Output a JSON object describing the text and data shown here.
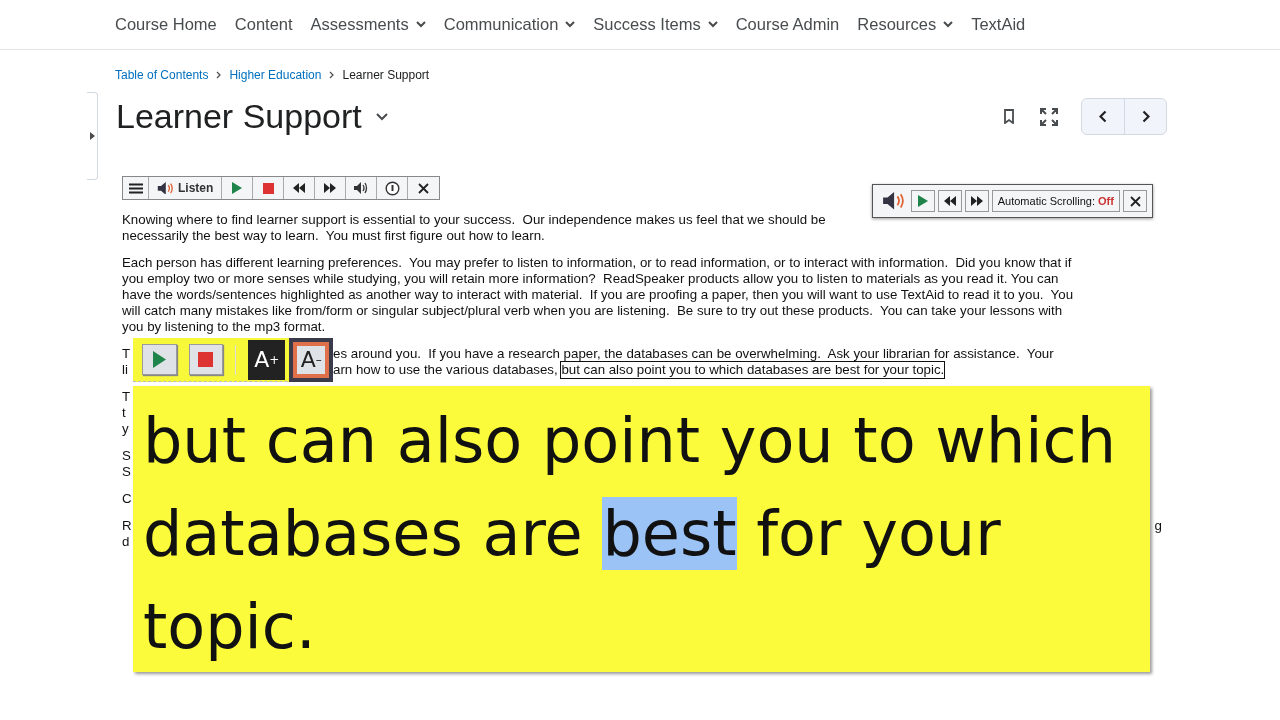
{
  "nav": [
    {
      "label": "Course Home",
      "dropdown": false
    },
    {
      "label": "Content",
      "dropdown": false
    },
    {
      "label": "Assessments",
      "dropdown": true
    },
    {
      "label": "Communication",
      "dropdown": true
    },
    {
      "label": "Success Items",
      "dropdown": true
    },
    {
      "label": "Course Admin",
      "dropdown": false
    },
    {
      "label": "Resources",
      "dropdown": true
    },
    {
      "label": "TextAid",
      "dropdown": false
    }
  ],
  "breadcrumbs": [
    {
      "label": "Table of Contents",
      "kind": "link"
    },
    {
      "label": "Higher Education",
      "kind": "link"
    },
    {
      "label": "Learner Support",
      "kind": "current"
    }
  ],
  "title": "Learner Support",
  "readspeaker": {
    "listen_label": "Listen"
  },
  "paragraphs": [
    {
      "lines": [
        {
          "head": "Knowing where to find learner support is essential to your success.  Our independence makes us feel that we should be"
        },
        {
          "head": "necessarily the best way to learn.  You must first figure out how to learn."
        }
      ]
    },
    {
      "lines": [
        {
          "head": "Each person has different learning preferences.  You may prefer to listen to information, or to read information, or to interact with information.  Did you know that if"
        },
        {
          "head": "you employ two or more senses while studying, you will retain more information?  ReadSpeaker products allow you to listen to materials as you read it. You can"
        },
        {
          "head": "have the words/sentences highlighted as another way to interact with material.  If you are proofing a paper, then you will want to use TextAid to read it to you.  You"
        },
        {
          "head": "will catch many mistakes like from/form or singular subject/plural verb when you are listening.  Be sure to try out these products.  You can take your lessons with"
        },
        {
          "head": "you by listening to the mp3 format."
        }
      ]
    },
    {
      "lines": [
        {
          "head": "T",
          "kind": "near",
          "tail": "es around you.  If you have a research paper, the databases can be overwhelming.  Ask your librarian for assistance.  Your"
        },
        {
          "head": "li",
          "kind": "near",
          "tail": "arn how to use the various databases, ",
          "current": "but can also point you to which databases are best for your topic."
        }
      ]
    },
    {
      "lines": [
        {
          "head": "T"
        },
        {
          "head": "t"
        },
        {
          "head": "y"
        }
      ]
    },
    {
      "lines": [
        {
          "head": "S"
        },
        {
          "head": "S"
        }
      ]
    },
    {
      "lines": [
        {
          "head": "C"
        }
      ]
    },
    {
      "lines": [
        {
          "head": "R",
          "kind": "far",
          "tail": "g"
        },
        {
          "head": "d"
        }
      ]
    }
  ],
  "scroll_toolbar": {
    "label": "Automatic Scrolling:",
    "state": "Off"
  },
  "textaid": {
    "size_buttons": [
      {
        "label": "A$^{+}$",
        "selected": false
      },
      {
        "label": "A$^{–}$",
        "selected": true
      }
    ],
    "reading": {
      "before": "but can also point you to which databases are ",
      "highlight": "best",
      "after": " for your topic."
    }
  }
}
